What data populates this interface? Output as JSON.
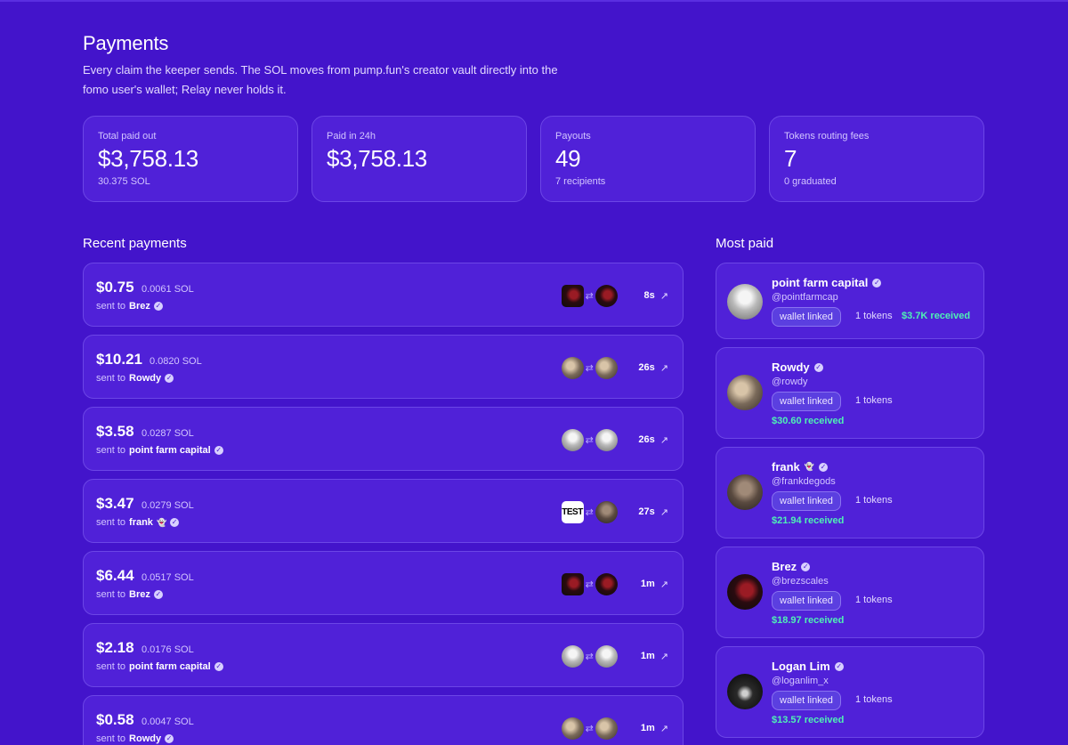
{
  "page": {
    "title": "Payments",
    "description": "Every claim the keeper sends. The SOL moves from pump.fun's creator vault directly into the fomo user's wallet; Relay never holds it."
  },
  "stats": [
    {
      "label": "Total paid out",
      "value": "$3,758.13",
      "sub": "30.375 SOL"
    },
    {
      "label": "Paid in 24h",
      "value": "$3,758.13",
      "sub": ""
    },
    {
      "label": "Payouts",
      "value": "49",
      "sub": "7 recipients"
    },
    {
      "label": "Tokens routing fees",
      "value": "7",
      "sub": "0 graduated"
    }
  ],
  "recent": {
    "title": "Recent payments",
    "sent_to_label": "sent to",
    "items": [
      {
        "amount": "$0.75",
        "sol": "0.0061 SOL",
        "recipient": "Brez",
        "time": "8s",
        "from_art": "dark",
        "to_art": "dark"
      },
      {
        "amount": "$10.21",
        "sol": "0.0820 SOL",
        "recipient": "Rowdy",
        "time": "26s",
        "from_art": "rowdy",
        "to_art": "rowdy"
      },
      {
        "amount": "$3.58",
        "sol": "0.0287 SOL",
        "recipient": "point farm capital",
        "time": "26s",
        "from_art": "pfc",
        "to_art": "pfc"
      },
      {
        "amount": "$3.47",
        "sol": "0.0279 SOL",
        "recipient": "frank",
        "ghost": "👻",
        "time": "27s",
        "from_art": "test",
        "from_text": "TEST",
        "to_art": "frank"
      },
      {
        "amount": "$6.44",
        "sol": "0.0517 SOL",
        "recipient": "Brez",
        "time": "1m",
        "from_art": "dark",
        "to_art": "dark"
      },
      {
        "amount": "$2.18",
        "sol": "0.0176 SOL",
        "recipient": "point farm capital",
        "time": "1m",
        "from_art": "pfc",
        "to_art": "pfc"
      },
      {
        "amount": "$0.58",
        "sol": "0.0047 SOL",
        "recipient": "Rowdy",
        "time": "1m",
        "from_art": "rowdy",
        "to_art": "rowdy"
      }
    ]
  },
  "most_paid": {
    "title": "Most paid",
    "users": [
      {
        "name": "point farm capital",
        "handle": "@pointfarmcap",
        "badge": "wallet linked",
        "tokens": "1 tokens",
        "received": "$3.7K received",
        "art": "pfc",
        "inline": true
      },
      {
        "name": "Rowdy",
        "handle": "@rowdy",
        "badge": "wallet linked",
        "tokens": "1 tokens",
        "received": "$30.60 received",
        "art": "rowdy",
        "inline": false
      },
      {
        "name": "frank",
        "ghost": "👻",
        "handle": "@frankdegods",
        "badge": "wallet linked",
        "tokens": "1 tokens",
        "received": "$21.94 received",
        "art": "frank",
        "inline": false
      },
      {
        "name": "Brez",
        "handle": "@brezscales",
        "badge": "wallet linked",
        "tokens": "1 tokens",
        "received": "$18.97 received",
        "art": "dark",
        "inline": false
      },
      {
        "name": "Logan Lim",
        "handle": "@loganlim_x",
        "badge": "wallet linked",
        "tokens": "1 tokens",
        "received": "$13.57 received",
        "art": "logan",
        "inline": false
      }
    ]
  },
  "icons": {
    "verified": "verified-check-icon",
    "swap": "swap-arrows-icon",
    "external": "external-link-arrow-icon"
  },
  "colors": {
    "background": "#4314cb",
    "card": "#5021d8",
    "received_green": "#4ff0b5"
  }
}
